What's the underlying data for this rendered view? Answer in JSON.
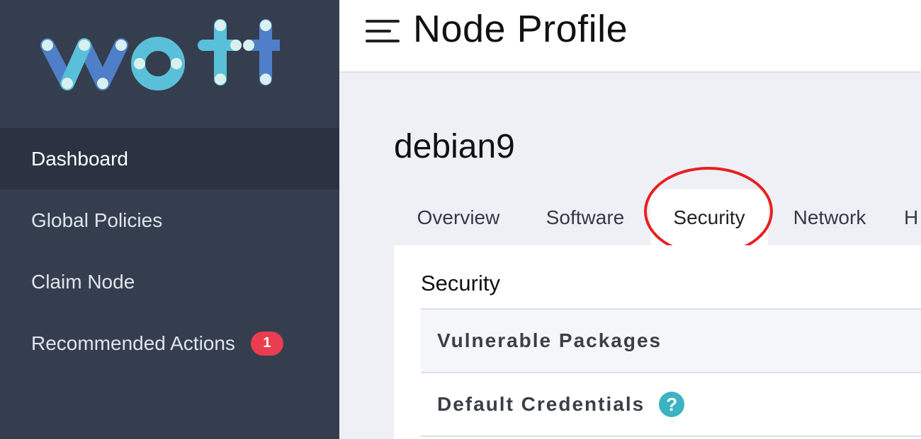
{
  "logo": {
    "text": "wott"
  },
  "sidebar": {
    "items": [
      {
        "label": "Dashboard"
      },
      {
        "label": "Global Policies"
      },
      {
        "label": "Claim Node"
      },
      {
        "label": "Recommended Actions",
        "badge": "1"
      }
    ]
  },
  "header": {
    "title": "Node Profile"
  },
  "node": {
    "name": "debian9"
  },
  "tabs": [
    {
      "label": "Overview"
    },
    {
      "label": "Software"
    },
    {
      "label": "Security"
    },
    {
      "label": "Network"
    },
    {
      "label": "H"
    }
  ],
  "security": {
    "title": "Security",
    "rows": [
      {
        "label": "Vulnerable Packages"
      },
      {
        "label": "Default Credentials",
        "help": "?"
      }
    ]
  },
  "colors": {
    "sidebar": "#353e4e",
    "sidebar_active": "#2b3342",
    "badge": "#ea3d4f",
    "help": "#3bb3c3",
    "highlight_circle": "#e8201f"
  }
}
